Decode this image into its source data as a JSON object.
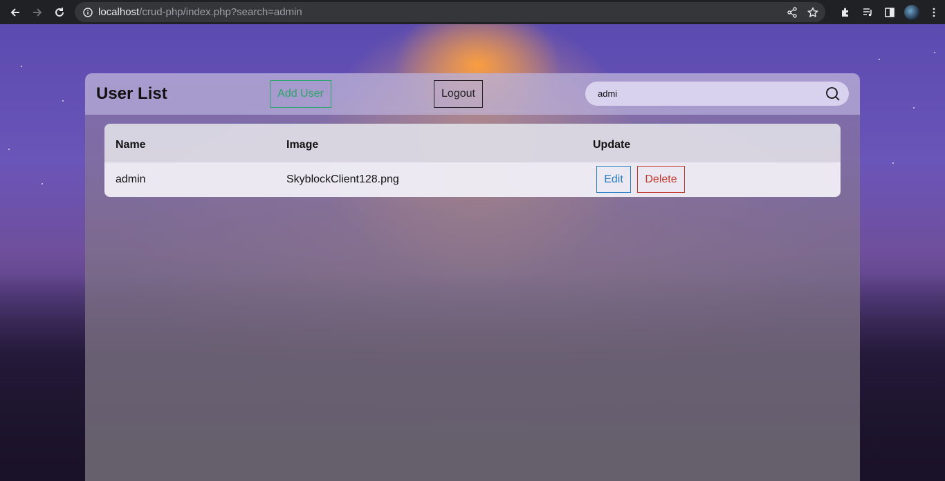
{
  "browser": {
    "url_host": "localhost",
    "url_path": "/crud-php/index.php?search=admin"
  },
  "page": {
    "title": "User List",
    "add_user_label": "Add User",
    "logout_label": "Logout",
    "search_value": "admi"
  },
  "table": {
    "headers": {
      "name": "Name",
      "image": "Image",
      "update": "Update"
    },
    "rows": [
      {
        "name": "admin",
        "image": "SkyblockClient128.png",
        "edit_label": "Edit",
        "delete_label": "Delete"
      }
    ]
  },
  "colors": {
    "add_user": "#2fa36b",
    "edit": "#2b7fc0",
    "delete": "#c23a2e"
  }
}
